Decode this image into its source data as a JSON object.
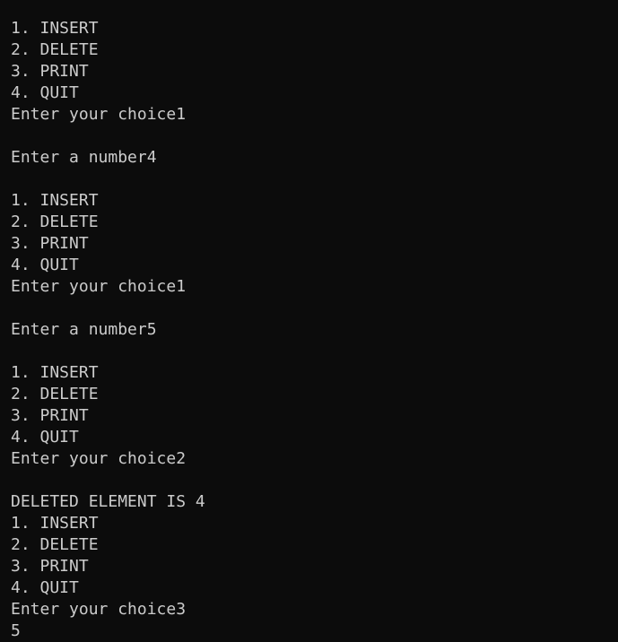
{
  "terminal": {
    "lines": [
      "1. INSERT",
      "2. DELETE",
      "3. PRINT",
      "4. QUIT",
      "Enter your choice1",
      "",
      "Enter a number4",
      "",
      "1. INSERT",
      "2. DELETE",
      "3. PRINT",
      "4. QUIT",
      "Enter your choice1",
      "",
      "Enter a number5",
      "",
      "1. INSERT",
      "2. DELETE",
      "3. PRINT",
      "4. QUIT",
      "Enter your choice2",
      "",
      "DELETED ELEMENT IS 4",
      "1. INSERT",
      "2. DELETE",
      "3. PRINT",
      "4. QUIT",
      "Enter your choice3",
      "5"
    ],
    "colors": {
      "background": "#0c0c0c",
      "text": "#cccccc"
    }
  }
}
